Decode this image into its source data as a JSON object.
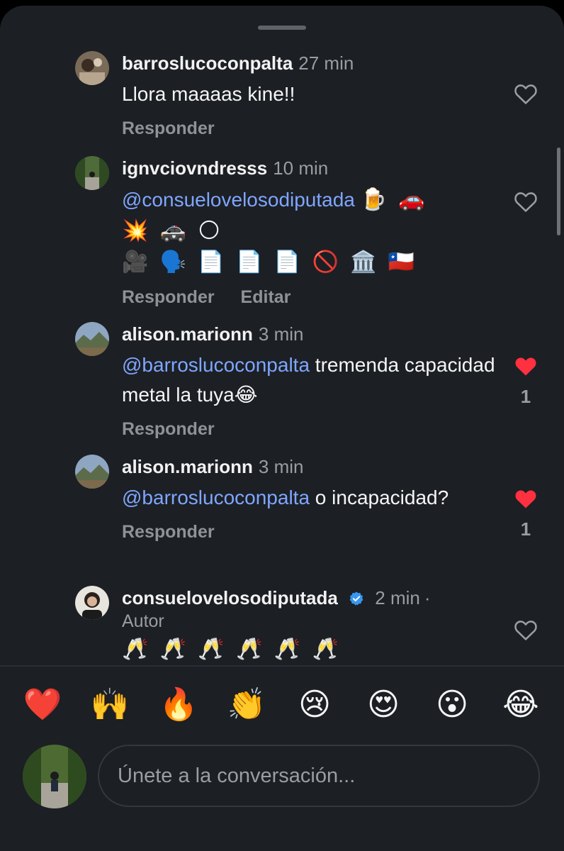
{
  "sheet": {
    "grabber": "drag-handle"
  },
  "comments": [
    {
      "username": "barroslucoconpalta",
      "time": "27 min",
      "text": "Llora maaaas kine!!",
      "reply_label": "Responder",
      "liked": false,
      "likes": ""
    },
    {
      "username": "ignvciovndresss",
      "time": "10 min",
      "mention": "@consuelovelosodiputada",
      "emoji_line1": "🍺 🚗",
      "emoji_line2": "💥 🚓 🌕",
      "emoji_line3": "🎥 🗣️ 📄 📄 📄 🚫 🏛️ 🇨🇱",
      "reply_label": "Responder",
      "edit_label": "Editar",
      "liked": false,
      "likes": ""
    },
    {
      "username": "alison.marionn",
      "time": "3 min",
      "mention": "@barroslucoconpalta",
      "text": " tremenda capacidad metal la tuya😂",
      "reply_label": "Responder",
      "liked": true,
      "likes": "1"
    },
    {
      "username": "alison.marionn",
      "time": "3 min",
      "mention": "@barroslucoconpalta",
      "text": " o incapacidad?",
      "reply_label": "Responder",
      "liked": true,
      "likes": "1"
    },
    {
      "username": "consuelovelosodiputada",
      "time": "2 min",
      "separator": "·",
      "role": "Autor",
      "emoji_text": "🥂 🥂 🥂 🥂 🥂 🥂",
      "liked": false,
      "likes": ""
    }
  ],
  "reactions": [
    "❤️",
    "🙌",
    "🔥",
    "👏",
    "😢",
    "😍",
    "😮",
    "😂"
  ],
  "composer": {
    "placeholder": "Únete a la conversación..."
  },
  "colors": {
    "background": "#1c1f24",
    "mention": "#7fa6ff",
    "like_red": "#ff3040",
    "muted": "#9a9da1"
  }
}
